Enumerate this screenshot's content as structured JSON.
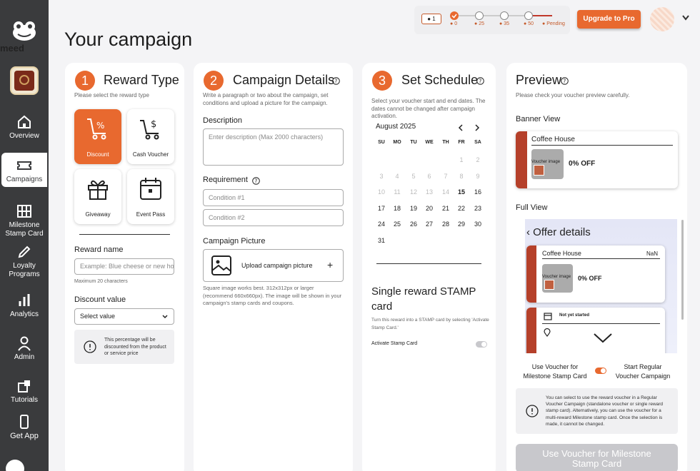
{
  "sidebar": {
    "brand": "meed",
    "items": [
      {
        "label": "Overview",
        "icon": "home-icon"
      },
      {
        "label": "Campaigns",
        "icon": "ticket-icon"
      },
      {
        "label": "Milestone Stamp Card",
        "icon": "grid-icon"
      },
      {
        "label": "Loyalty Programs",
        "icon": "pen-icon"
      },
      {
        "label": "Analytics",
        "icon": "bar-chart-icon"
      },
      {
        "label": "Admin",
        "icon": "user-icon"
      },
      {
        "label": "Tutorials",
        "icon": "tutorial-icon"
      },
      {
        "label": "Get App",
        "icon": "phone-icon"
      }
    ]
  },
  "topbar": {
    "user_count": "1",
    "steps": [
      "0",
      "25",
      "35",
      "50",
      "Pending"
    ],
    "upgrade_label": "Upgrade to Pro"
  },
  "page_title": "Your campaign",
  "step1": {
    "number": "1",
    "title": "Reward Type",
    "subtitle": "Please select the reward type",
    "types": [
      "Discount",
      "Cash Voucher",
      "Giveaway",
      "Event Pass"
    ],
    "reward_name_label": "Reward name",
    "reward_name_placeholder": "Example: Blue cheese or new ho",
    "reward_name_hint": "Maximum 20 characters",
    "discount_label": "Discount value",
    "discount_select": "Select value",
    "info": "This percentage will be discounted from the product or service price"
  },
  "step2": {
    "number": "2",
    "title": "Campaign Details",
    "subtitle": "Write a paragraph or two about the campaign, set conditions and upload a picture for the campaign.",
    "description_label": "Description",
    "description_placeholder": "Enter description (Max 2000 characters)",
    "requirement_label": "Requirement",
    "conditions": [
      "Condition #1",
      "Condition #2"
    ],
    "picture_label": "Campaign Picture",
    "upload_label": "Upload campaign picture",
    "picture_note": "Square image works best. 312x312px or larger (recommend 660x660px). The image will be shown in your campaign's stamp cards and coupons."
  },
  "step3": {
    "number": "3",
    "title": "Set Schedule",
    "subtitle": "Select your voucher start and end dates. The dates cannot be changed after campaign activation.",
    "month": "August 2025",
    "weekdays": [
      "SU",
      "MO",
      "TU",
      "WE",
      "TH",
      "FR",
      "SA"
    ],
    "stamp_title": "Single reward STAMP card",
    "stamp_sub": "Turn this reward into a STAMP card by selecting 'Activate Stamp Card.'",
    "activate_label": "Activate Stamp Card"
  },
  "preview": {
    "title": "Preview",
    "subtitle": "Please check your voucher preview carefully.",
    "banner_label": "Banner View",
    "store_name": "Coffee House",
    "voucher_image": "Voucher image",
    "offer": "0% OFF",
    "full_label": "Full View",
    "offer_details": "Offer details",
    "nan": "NaN",
    "not_started": "Not yet started",
    "toggle_left": "Use Voucher for Milestone Stamp Card",
    "toggle_right": "Start Regular Voucher Campaign",
    "info": "You can select to use the reward voucher in a Regular Voucher Campaign (standalone voucher or single reward stamp card). Alternatively, you can use the voucher for a multi-reward Milestone stamp card. Once the selection is made, it cannot be changed.",
    "button": "Use Voucher for Milestone Stamp Card"
  },
  "colors": {
    "accent": "#e8692f",
    "sidebar": "#3a3b3d",
    "brand_red": "#b5402a"
  }
}
